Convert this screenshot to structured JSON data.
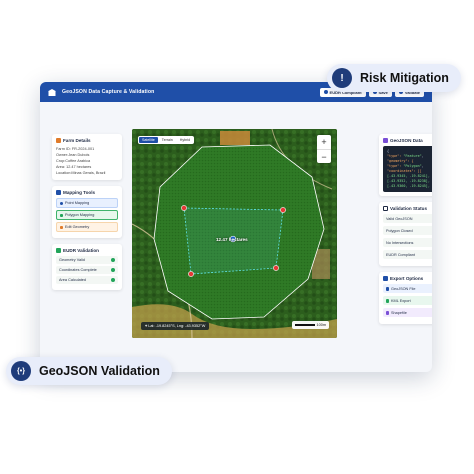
{
  "window": {
    "title": "GeoJSON Data Capture & Validation",
    "buttons": [
      {
        "label": "EUDR Compliant"
      },
      {
        "label": "Save"
      },
      {
        "label": "Validate"
      }
    ]
  },
  "farm_details": {
    "title": "Farm Details",
    "fields": [
      "Farm ID: FR-2024-001",
      "Owner:Jean Dubois",
      "Crop:Coffee Arabica",
      "Area: 12.47 hectares",
      "Location:Minas Gerais, Brazil"
    ]
  },
  "mapping_tools": {
    "title": "Mapping Tools",
    "items": [
      "Point Mapping",
      "Polygon Mapping",
      "Edit Geometry"
    ]
  },
  "eudr_validation": {
    "title": "EUDR Validation",
    "items": [
      "Geometry Valid",
      "Coordinates Complete",
      "Area Calculated"
    ]
  },
  "map": {
    "tabs": [
      "Satellite",
      "Terrain",
      "Hybrid"
    ],
    "zoom_in": "+",
    "zoom_out": "−",
    "area_label": "12.47 hectares",
    "coords": "Lat: -19.8245°S, Lng: -43.9352°W",
    "scale": "100m"
  },
  "geojson_data": {
    "title": "GeoJSON Data",
    "lines": [
      [
        "{",
        "",
        ""
      ],
      [
        "  \"type\": ",
        "\"Feature\"",
        ","
      ],
      [
        "  \"geometry\": {",
        "",
        ""
      ],
      [
        "    \"type\": ",
        "\"Polygon\"",
        ","
      ],
      [
        "    \"coordinates\": [[",
        "",
        ""
      ],
      [
        "      [-43.9345, -19.8241],",
        "",
        ""
      ],
      [
        "      [-43.9352, -19.8238],",
        "",
        ""
      ],
      [
        "      [-43.9360, -19.8245],",
        "",
        ""
      ]
    ]
  },
  "validation_status": {
    "title": "Validation Status",
    "items": [
      "Valid GeoJSON",
      "Polygon Closed",
      "No Intersections",
      "EUDR Compliant"
    ]
  },
  "export_options": {
    "title": "Export Options",
    "items": [
      "GeoJSON File",
      "KML Export",
      "Shapefile"
    ]
  },
  "badges": {
    "risk": "Risk Mitigation",
    "geojson": "GeoJSON Validation"
  },
  "colors": {
    "brand": "#1f4fa8",
    "success": "#22a55a",
    "canvas": "#f4f6fa"
  }
}
